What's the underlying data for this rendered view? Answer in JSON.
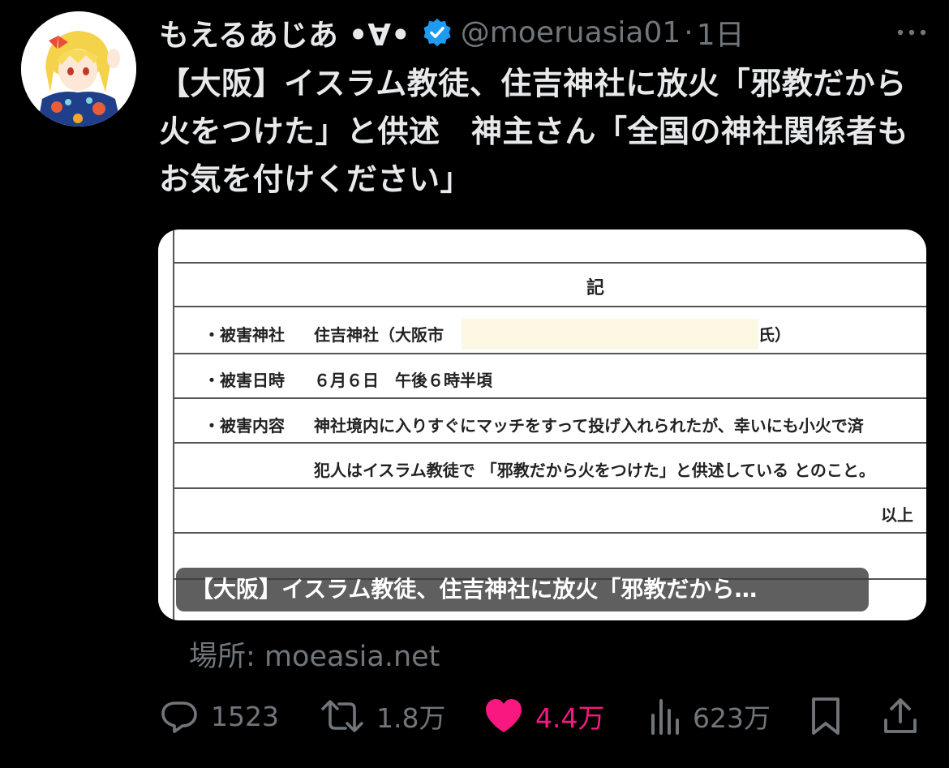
{
  "tweet": {
    "author": {
      "display_name": "もえるあじあ •∀•",
      "handle": "@moeruasia01",
      "verified": true
    },
    "separator": "·",
    "timestamp": "1日",
    "text": "【大阪】イスラム教徒、住吉神社に放火「邪教だから火をつけた」と供述　神主さん「全国の神社関係者もお気を付けください」",
    "media": {
      "document": {
        "heading": "記",
        "rows": [
          {
            "label": "・被害神社",
            "value": "住吉神社（大阪市",
            "value_suffix": "氏）"
          },
          {
            "label": "・被害日時",
            "value": "６月６日　午後６時半頃"
          },
          {
            "label": "・被害内容",
            "value": "神社境内に入りすぐにマッチをすって投げ入れられたが、幸いにも小火で済"
          },
          {
            "label": "",
            "value": "犯人はイスラム教徒で 「邪教だから火をつけた」と供述している とのこと。"
          }
        ],
        "closing": "以上"
      },
      "caption": "【大阪】イスラム教徒、住吉神社に放火「邪教だから…"
    },
    "location": {
      "label": "場所:",
      "domain": "moeasia.net"
    },
    "actions": {
      "replies": "1523",
      "retweets": "1.8万",
      "likes": "4.4万",
      "views": "623万"
    }
  },
  "colors": {
    "background": "#000000",
    "text_primary": "#e7e9ea",
    "text_secondary": "#71767b",
    "verified_blue": "#1d9bf0",
    "like_pink": "#f91880"
  },
  "icons": {
    "more": "more-horizontal-icon",
    "verified": "verified-badge-icon",
    "reply": "reply-bubble-icon",
    "retweet": "retweet-icon",
    "like": "heart-filled-icon",
    "views": "bar-chart-icon",
    "bookmark": "bookmark-icon",
    "share": "share-upload-icon"
  }
}
